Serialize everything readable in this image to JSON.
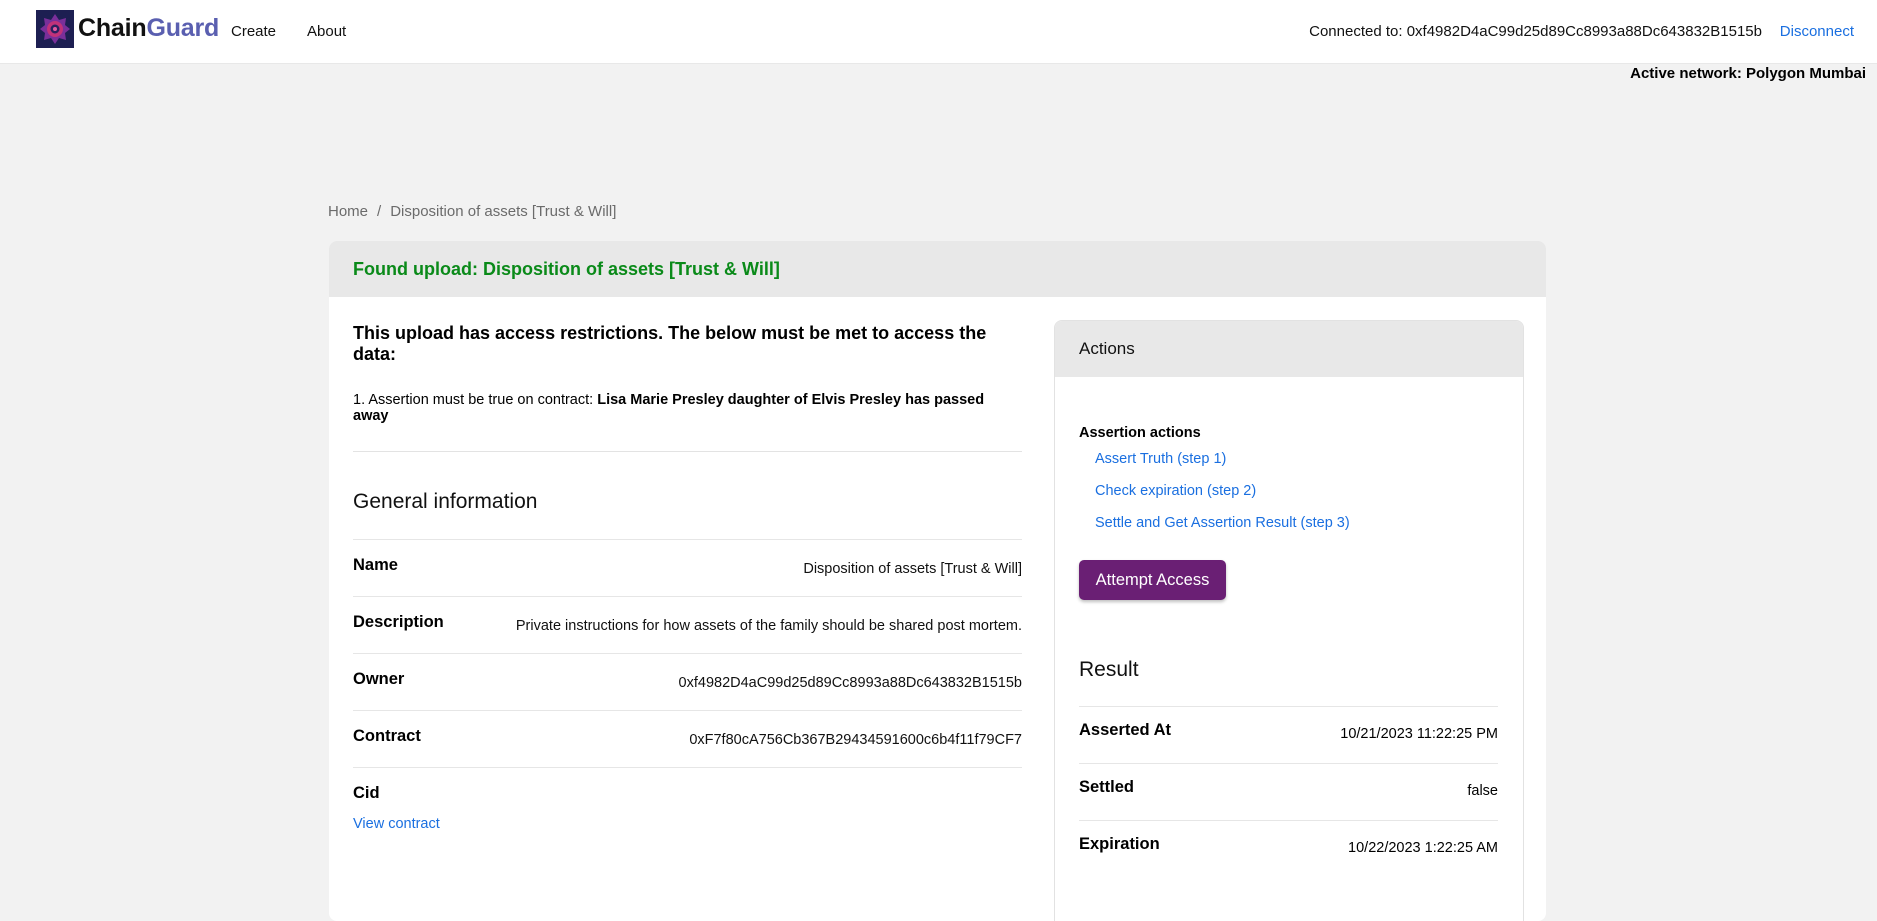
{
  "navbar": {
    "brand_part1": "Chain",
    "brand_part2": "Guard",
    "links": [
      "Create",
      "About"
    ],
    "connected_text": "Connected to: 0xf4982D4aC99d25d89Cc8993a88Dc643832B1515b",
    "disconnect_label": "Disconnect",
    "network_text": "Active network: Polygon Mumbai"
  },
  "breadcrumb": {
    "home": "Home",
    "separator": "/",
    "current": "Disposition of assets [Trust & Will]"
  },
  "card": {
    "header": "Found upload: Disposition of assets [Trust & Will]",
    "restrictions_title": "This upload has access restrictions. The below must be met to access the data:",
    "restriction_prefix": "1. Assertion must be true on contract: ",
    "restriction_assertion": "Lisa Marie Presley daughter of Elvis Presley has passed away",
    "general_title": "General information",
    "info": [
      {
        "key": "Name",
        "value": "Disposition of assets [Trust & Will]"
      },
      {
        "key": "Description",
        "value": "Private instructions for how assets of the family should be shared post mortem."
      },
      {
        "key": "Owner",
        "value": "0xf4982D4aC99d25d89Cc8993a88Dc643832B1515b"
      },
      {
        "key": "Contract",
        "value": "0xF7f80cA756Cb367B29434591600c6b4f11f79CF7"
      },
      {
        "key": "Cid",
        "value": ""
      }
    ],
    "view_contract": "View contract"
  },
  "actions": {
    "title": "Actions",
    "assertion_label": "Assertion actions",
    "links": [
      "Assert Truth (step 1)",
      "Check expiration (step 2)",
      "Settle and Get Assertion Result (step 3)"
    ],
    "attempt_button": "Attempt Access",
    "result_title": "Result",
    "results": [
      {
        "key": "Asserted At",
        "value": "10/21/2023 11:22:25 PM"
      },
      {
        "key": "Settled",
        "value": "false"
      },
      {
        "key": "Expiration",
        "value": "10/22/2023 1:22:25 AM"
      }
    ]
  },
  "colors": {
    "accent_link": "#1a6fe0",
    "success_text": "#0a8a19",
    "button": "#6a1f74",
    "brand_secondary": "#5a5fb0"
  }
}
